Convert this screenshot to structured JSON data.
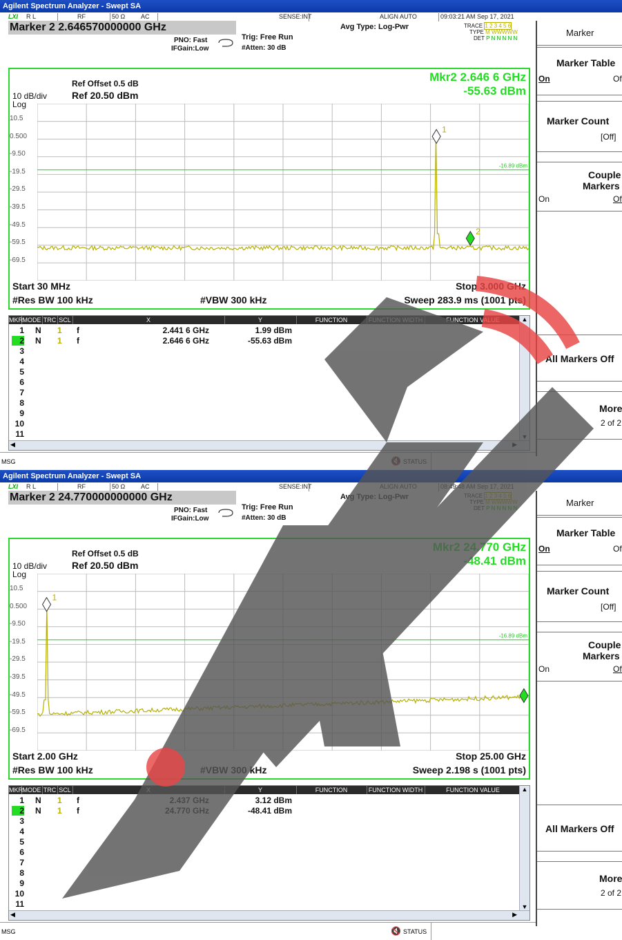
{
  "colors": {
    "accent_green": "#22dd22",
    "trace_yellow": "#b6b000",
    "title_blue": "#0b3aa8",
    "watermark_dark": "#555555",
    "watermark_red": "#e84545"
  },
  "panels": [
    {
      "window_title": "Agilent Spectrum Analyzer - Swept SA",
      "status": {
        "rl": "R L",
        "rf": "RF",
        "imp": "50 Ω",
        "ac": "AC",
        "sense": "SENSE:INT",
        "align": "ALIGN AUTO",
        "datetime": "09:03:21 AM Sep 17, 2021"
      },
      "marker_header": "Marker 2  2.646570000000 GHz",
      "pno": "PNO: Fast",
      "ifgain": "IFGain:Low",
      "trig": "Trig: Free Run",
      "atten": "#Atten: 30 dB",
      "avg": "Avg Type: Log-Pwr",
      "trace": {
        "trace_label": "TRACE",
        "trace_vals": "1 2 3 4 5 6",
        "type_label": "TYPE",
        "type_vals": "M WWWWW",
        "det_label": "DET",
        "det_vals": "P N N N N N"
      },
      "ref_offset": "Ref Offset 0.5 dB",
      "ref": "Ref 20.50 dBm",
      "scale": "10 dB/div",
      "log": "Log",
      "mkr_readout_freq": "Mkr2 2.646 6 GHz",
      "mkr_readout_amp": "-55.63 dBm",
      "ylabels": [
        "10.5",
        "0.500",
        "-9.50",
        "-19.5",
        "-29.5",
        "-39.5",
        "-49.5",
        "-59.5",
        "-69.5"
      ],
      "display_line": "-16.89 dBm",
      "start": "Start 30 MHz",
      "stop": "Stop 3.000 GHz",
      "rbw": "#Res BW 100 kHz",
      "vbw": "#VBW 300 kHz",
      "sweep": "Sweep  283.9 ms (1001 pts)",
      "chart_data": {
        "type": "line",
        "x_range_ghz": [
          0.03,
          3.0
        ],
        "ylim": [
          -79.5,
          20.5
        ],
        "noise_floor_dbm": -61,
        "peaks": [
          {
            "marker": "1",
            "x_ghz": 2.4416,
            "y_dbm": 1.99
          },
          {
            "marker": "2",
            "x_ghz": 2.6466,
            "y_dbm": -55.63
          }
        ],
        "display_line_dbm": -16.89
      },
      "table": {
        "headers": [
          "MKR",
          "MODE",
          "TRC",
          "SCL",
          "X",
          "Y",
          "FUNCTION",
          "FUNCTION WIDTH",
          "FUNCTION VALUE"
        ],
        "rows": [
          {
            "n": "1",
            "mode": "N",
            "trc": "1",
            "scl": "f",
            "x": "2.441 6 GHz",
            "y": "1.99 dBm"
          },
          {
            "n": "2",
            "mode": "N",
            "trc": "1",
            "scl": "f",
            "x": "2.646 6 GHz",
            "y": "-55.63 dBm"
          }
        ],
        "empty_rows": [
          "3",
          "4",
          "5",
          "6",
          "7",
          "8",
          "9",
          "10",
          "11"
        ]
      },
      "msg": "MSG",
      "status_label": "STATUS",
      "softkeys": {
        "menu": "Marker",
        "marker_table": "Marker Table",
        "on": "On",
        "off": "Off",
        "marker_count": "Marker Count",
        "count_state": "[Off]",
        "couple": "Couple",
        "markers": "Markers",
        "all_off": "All Markers Off",
        "more": "More",
        "page": "2 of 2"
      }
    },
    {
      "window_title": "Agilent Spectrum Analyzer - Swept SA",
      "status": {
        "rl": "R L",
        "rf": "RF",
        "imp": "50 Ω",
        "ac": "AC",
        "sense": "SENSE:INT",
        "align": "ALIGN AUTO",
        "datetime": "08:49:48 AM Sep 17, 2021"
      },
      "marker_header": "Marker 2  24.770000000000 GHz",
      "pno": "PNO: Fast",
      "ifgain": "IFGain:Low",
      "trig": "Trig: Free Run",
      "atten": "#Atten: 30 dB",
      "avg": "Avg Type: Log-Pwr",
      "trace": {
        "trace_label": "TRACE",
        "trace_vals": "1 2 3 4 5 6",
        "type_label": "TYPE",
        "type_vals": "M WWWWW",
        "det_label": "DET",
        "det_vals": "P N N N N N"
      },
      "ref_offset": "Ref Offset 0.5 dB",
      "ref": "Ref 20.50 dBm",
      "scale": "10 dB/div",
      "log": "Log",
      "mkr_readout_freq": "Mkr2 24.770 GHz",
      "mkr_readout_amp": "-48.41 dBm",
      "ylabels": [
        "10.5",
        "0.500",
        "-9.50",
        "-19.5",
        "-29.5",
        "-39.5",
        "-49.5",
        "-59.5",
        "-69.5"
      ],
      "display_line": "-16.89 dBm",
      "start": "Start 2.00 GHz",
      "stop": "Stop 25.00 GHz",
      "rbw": "#Res BW 100 kHz",
      "vbw": "#VBW 300 kHz",
      "sweep": "Sweep  2.198 s (1001 pts)",
      "chart_data": {
        "type": "line",
        "x_range_ghz": [
          2.0,
          25.0
        ],
        "ylim": [
          -79.5,
          20.5
        ],
        "noise_floor_dbm_start": -59,
        "noise_floor_dbm_end": -49,
        "peaks": [
          {
            "marker": "1",
            "x_ghz": 2.437,
            "y_dbm": 3.12
          },
          {
            "marker": "2",
            "x_ghz": 24.77,
            "y_dbm": -48.41
          }
        ],
        "display_line_dbm": -16.89
      },
      "table": {
        "headers": [
          "MKR",
          "MODE",
          "TRC",
          "SCL",
          "X",
          "Y",
          "FUNCTION",
          "FUNCTION WIDTH",
          "FUNCTION VALUE"
        ],
        "rows": [
          {
            "n": "1",
            "mode": "N",
            "trc": "1",
            "scl": "f",
            "x": "2.437 GHz",
            "y": "3.12 dBm"
          },
          {
            "n": "2",
            "mode": "N",
            "trc": "1",
            "scl": "f",
            "x": "24.770 GHz",
            "y": "-48.41 dBm"
          }
        ],
        "empty_rows": [
          "3",
          "4",
          "5",
          "6",
          "7",
          "8",
          "9",
          "10",
          "11"
        ]
      },
      "msg": "MSG",
      "status_label": "STATUS",
      "softkeys": {
        "menu": "Marker",
        "marker_table": "Marker Table",
        "on": "On",
        "off": "Off",
        "marker_count": "Marker Count",
        "count_state": "[Off]",
        "couple": "Couple",
        "markers": "Markers",
        "all_off": "All Markers Off",
        "more": "More",
        "page": "2 of 2"
      }
    }
  ]
}
